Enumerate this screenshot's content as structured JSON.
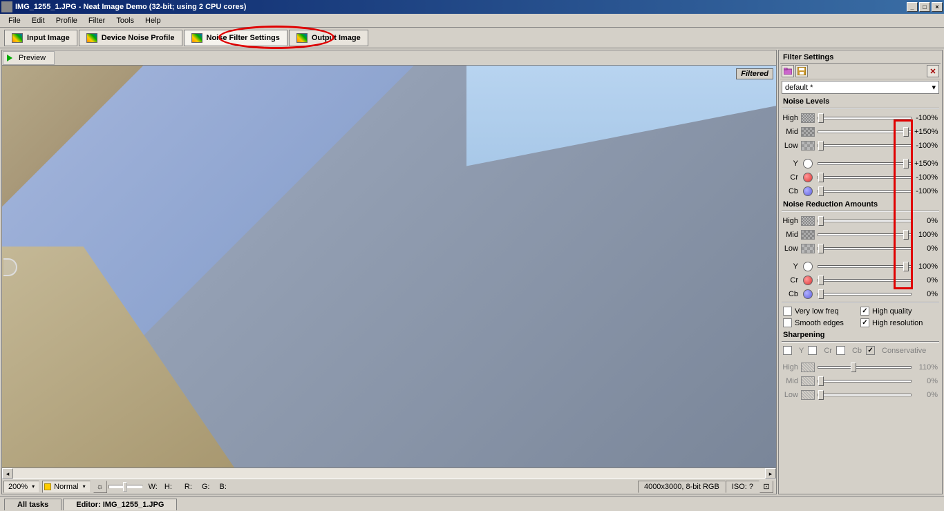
{
  "titlebar": {
    "text": "IMG_1255_1.JPG - Neat Image Demo (32-bit; using 2 CPU cores)"
  },
  "menubar": [
    "File",
    "Edit",
    "Profile",
    "Filter",
    "Tools",
    "Help"
  ],
  "tabs": {
    "input": "Input Image",
    "profile": "Device Noise Profile",
    "settings": "Noise Filter Settings",
    "output": "Output Image"
  },
  "preview_btn": "Preview",
  "filtered_badge": "Filtered",
  "bottom": {
    "zoom": "200%",
    "mode": "Normal",
    "w": "W:",
    "h": "H:",
    "r": "R:",
    "g": "G:",
    "b": "B:",
    "info1": "4000x3000, 8-bit RGB",
    "info2": "ISO: ?"
  },
  "task_tabs": {
    "all": "All tasks",
    "editor": "Editor: IMG_1255_1.JPG"
  },
  "panel": {
    "title": "Filter Settings",
    "preset": "default *",
    "noise_levels_header": "Noise Levels",
    "noise_reduction_header": "Noise Reduction Amounts",
    "sharpening_header": "Sharpening",
    "labels": {
      "high": "High",
      "mid": "Mid",
      "low": "Low",
      "y": "Y",
      "cr": "Cr",
      "cb": "Cb"
    },
    "levels": {
      "high": "-100%",
      "mid": "+150%",
      "low": "-100%",
      "y": "+150%",
      "cr": "-100%",
      "cb": "-100%"
    },
    "reduction": {
      "high": "0%",
      "mid": "100%",
      "low": "0%",
      "y": "100%",
      "cr": "0%",
      "cb": "0%"
    },
    "checks": {
      "vlf": "Very low freq",
      "smooth": "Smooth edges",
      "hq": "High quality",
      "hr": "High resolution"
    },
    "sharp_checks": {
      "y": "Y",
      "cr": "Cr",
      "cb": "Cb",
      "cons": "Conservative"
    },
    "sharp": {
      "high": "110%",
      "mid": "0%",
      "low": "0%"
    }
  }
}
